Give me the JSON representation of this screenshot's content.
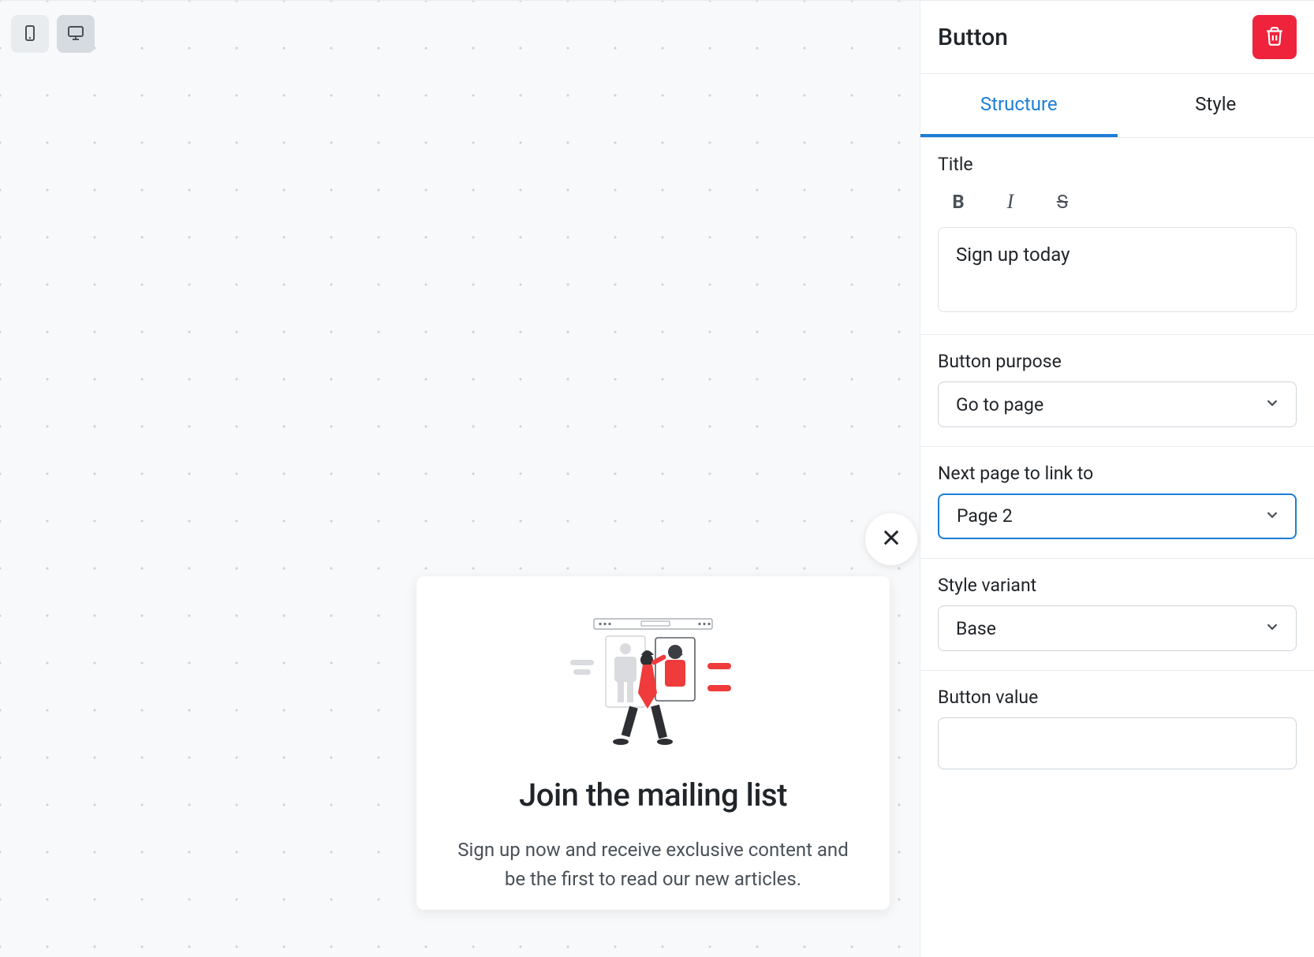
{
  "sidebar": {
    "title": "Button",
    "tabs": {
      "structure": "Structure",
      "style": "Style"
    },
    "sections": {
      "title_label": "Title",
      "title_value": "Sign up today",
      "purpose_label": "Button purpose",
      "purpose_value": "Go to page",
      "next_page_label": "Next page to link to",
      "next_page_value": "Page 2",
      "style_variant_label": "Style variant",
      "style_variant_value": "Base",
      "button_value_label": "Button value",
      "button_value_value": ""
    }
  },
  "popup": {
    "heading": "Join the mailing list",
    "body": "Sign up now and receive exclusive content and be the first to read our new articles."
  }
}
